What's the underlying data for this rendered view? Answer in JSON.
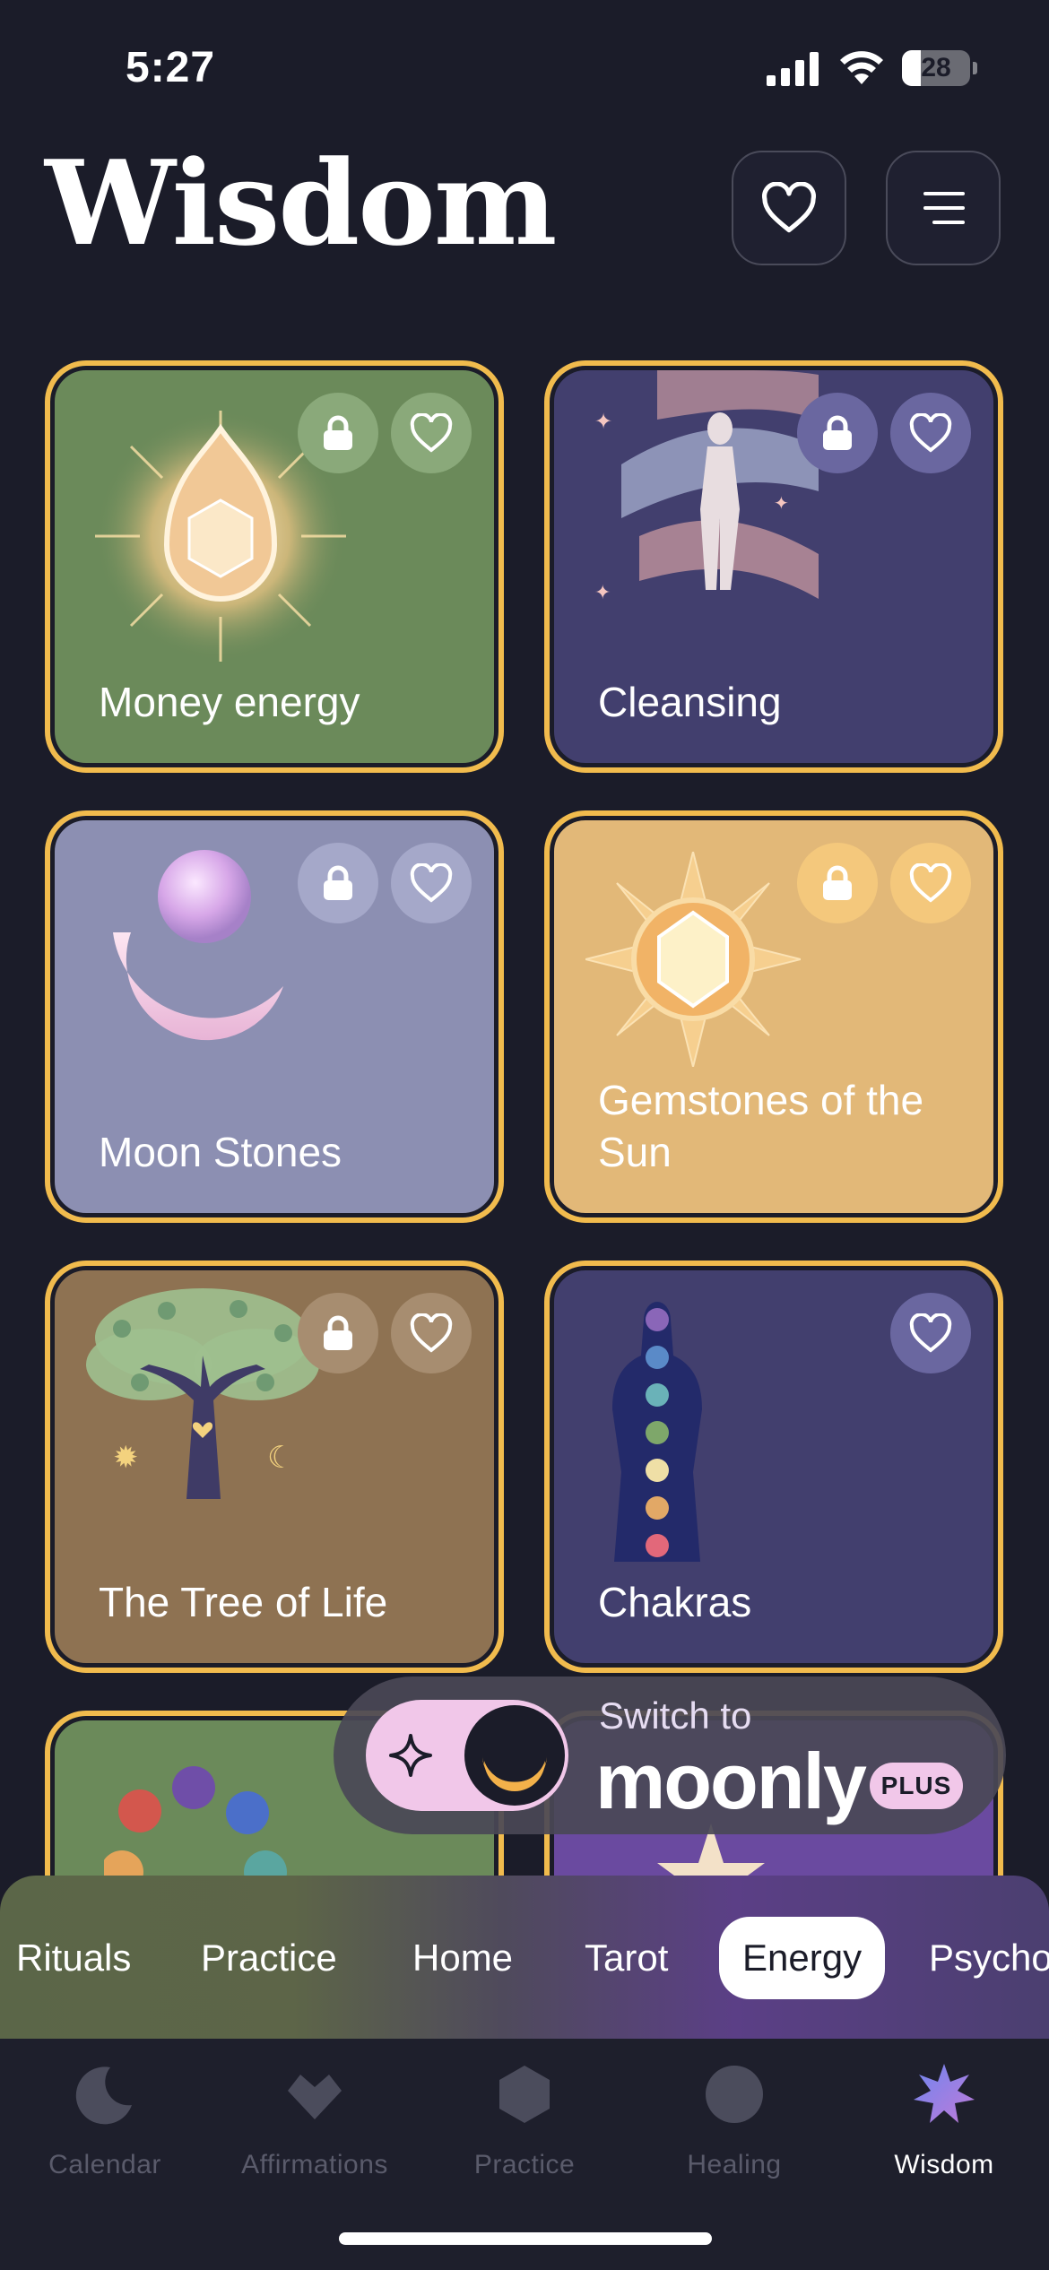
{
  "status_bar": {
    "time": "5:27",
    "battery_percent": "28",
    "battery_level": 0.28
  },
  "header": {
    "title": "Wisdom",
    "favorites_icon": "heart-icon",
    "menu_icon": "menu-icon"
  },
  "cards": [
    {
      "title": "Money energy",
      "locked": true,
      "color": "#6b8a5a"
    },
    {
      "title": "Cleansing",
      "locked": true,
      "color": "#423f6e"
    },
    {
      "title": "Moon Stones",
      "locked": true,
      "color": "#8c8fb2"
    },
    {
      "title": "Gemstones of the Sun",
      "locked": true,
      "color": "#e2b878"
    },
    {
      "title": "The Tree of Life",
      "locked": true,
      "color": "#8e7252"
    },
    {
      "title": "Chakras",
      "locked": false,
      "color": "#423f6e"
    }
  ],
  "promo": {
    "line1": "Switch to",
    "brand": "moonly",
    "badge": "PLUS"
  },
  "categories": {
    "items": [
      "Rituals",
      "Practice",
      "Home",
      "Tarot",
      "Energy",
      "Psycho"
    ],
    "active": "Energy"
  },
  "tabs": {
    "items": [
      "Calendar",
      "Affirmations",
      "Practice",
      "Healing",
      "Wisdom"
    ],
    "active": "Wisdom"
  },
  "colors": {
    "accent_gold": "#f1bb4d",
    "background": "#1b1c29",
    "promo_pink": "#f1c7e9"
  }
}
